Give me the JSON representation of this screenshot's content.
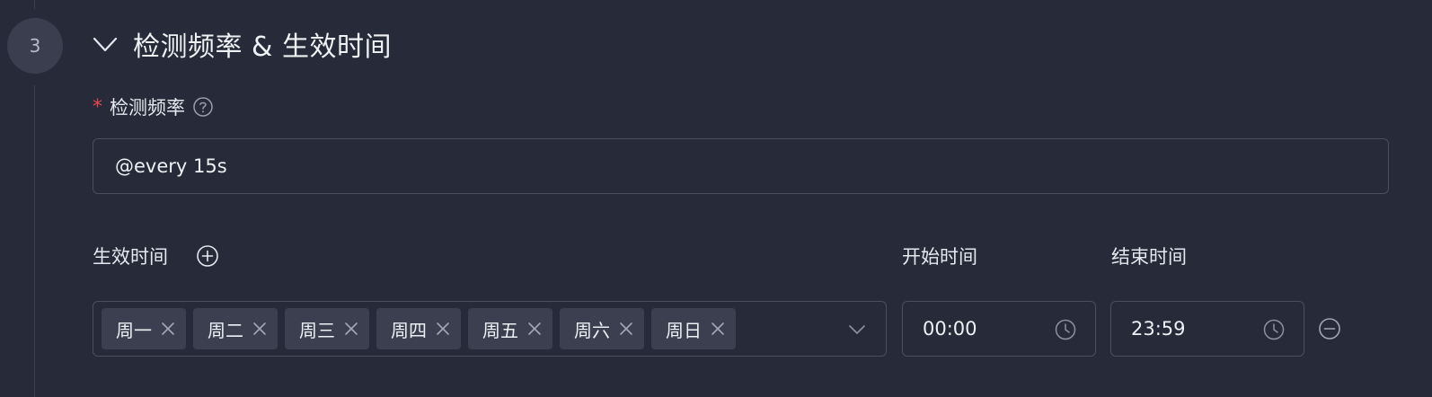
{
  "step": {
    "number": "3"
  },
  "section": {
    "title": "检测频率 & 生效时间"
  },
  "frequency": {
    "required_mark": "*",
    "label": "检测频率",
    "value": "@every 15s"
  },
  "schedule": {
    "effective_label": "生效时间",
    "start_label": "开始时间",
    "end_label": "结束时间",
    "days": [
      "周一",
      "周二",
      "周三",
      "周四",
      "周五",
      "周六",
      "周日"
    ],
    "start_time": "00:00",
    "end_time": "23:59"
  },
  "icons": {
    "collapse": "chevron-down-icon",
    "help": "question-circle-icon",
    "add": "plus-circle-icon",
    "tag_close": "close-icon",
    "select": "chevron-down-icon",
    "time": "clock-icon",
    "remove": "minus-circle-icon"
  }
}
